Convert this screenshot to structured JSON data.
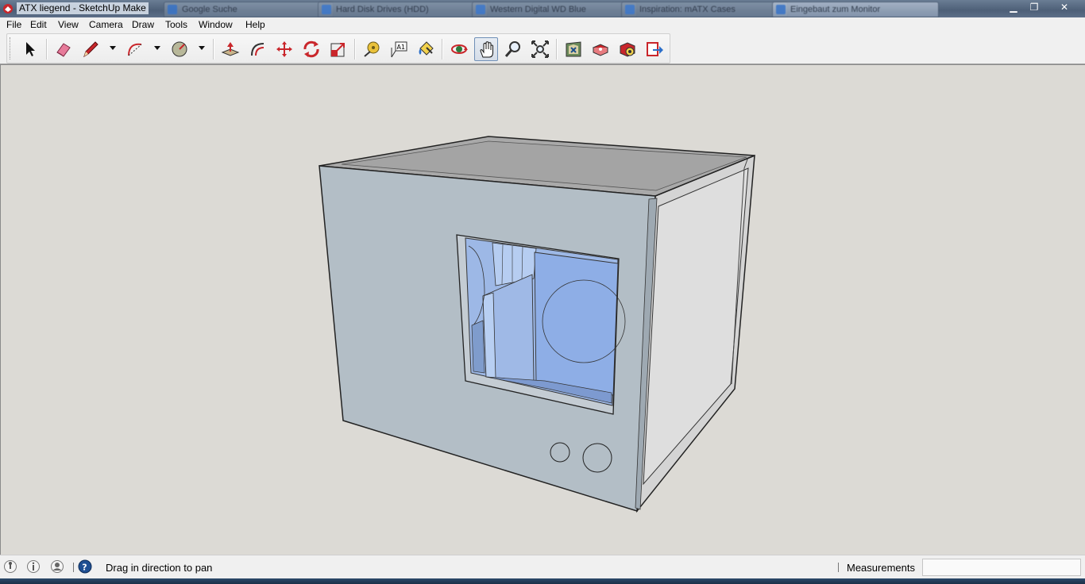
{
  "window": {
    "title": "ATX liegend - SketchUp Make",
    "background_tabs": [
      "Google Suche",
      "Hard Disk Drives (HDD)",
      "Western Digital WD Blue",
      "Inspiration: mATX Cases",
      "Eingebaut zum Monitor"
    ],
    "controls": {
      "minimize": "▁",
      "restore": "❐",
      "close": "✕"
    }
  },
  "menubar": {
    "items": [
      "File",
      "Edit",
      "View",
      "Camera",
      "Draw",
      "Tools",
      "Window",
      "Help"
    ]
  },
  "toolbar": {
    "tools": [
      {
        "icon": "select-arrow-icon"
      },
      {
        "icon": "eraser-icon"
      },
      {
        "icon": "pencil-line-icon",
        "has_dropdown": true
      },
      {
        "icon": "arc-icon",
        "has_dropdown": true
      },
      {
        "icon": "circle-shape-icon",
        "has_dropdown": true
      },
      {
        "icon": "push-pull-icon"
      },
      {
        "icon": "offset-icon"
      },
      {
        "icon": "move-icon"
      },
      {
        "icon": "rotate-icon"
      },
      {
        "icon": "scale-icon"
      },
      {
        "icon": "tape-measure-icon"
      },
      {
        "icon": "text-label-icon",
        "glyph": "A1"
      },
      {
        "icon": "paint-bucket-icon"
      },
      {
        "icon": "orbit-icon"
      },
      {
        "icon": "pan-hand-icon",
        "active": true
      },
      {
        "icon": "zoom-icon"
      },
      {
        "icon": "zoom-extents-icon"
      },
      {
        "icon": "3d-warehouse-icon"
      },
      {
        "icon": "share-model-icon"
      },
      {
        "icon": "extension-warehouse-icon"
      },
      {
        "icon": "send-to-layout-icon"
      }
    ]
  },
  "statusbar": {
    "icons": [
      "geo-location-icon",
      "credits-icon",
      "account-icon",
      "help-icon"
    ],
    "message": "Drag in direction to pan",
    "measurements_label": "Measurements",
    "measurements_value": ""
  },
  "colors": {
    "canvas": "#dcdad5",
    "model_front": "#b3bec6",
    "model_side": "#d3d3d3",
    "model_top": "#a8a8a8",
    "glass": "#9db8e6"
  }
}
